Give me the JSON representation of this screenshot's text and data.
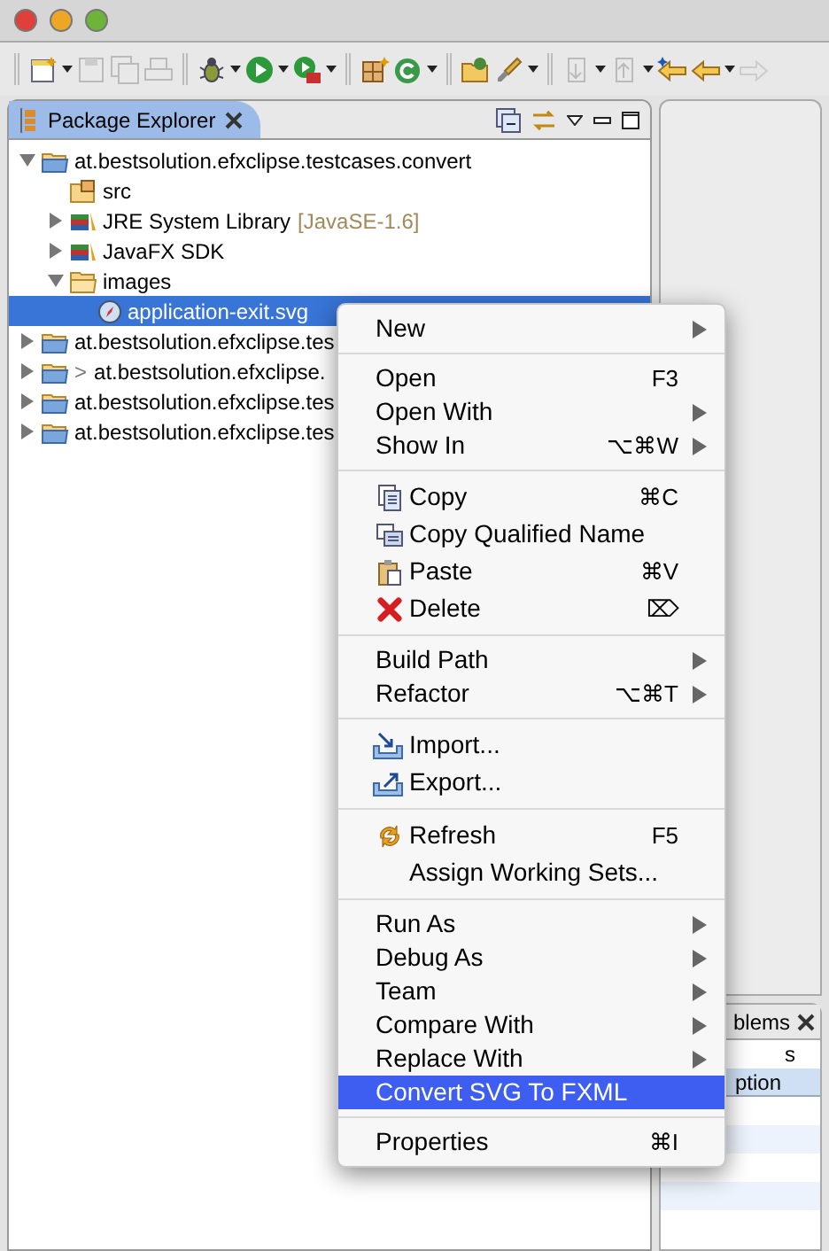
{
  "view_tab": {
    "label": "Package Explorer",
    "selected": true
  },
  "tree": [
    {
      "kind": "project",
      "label": "at.bestsolution.efxclipse.testcases.convert",
      "expanded": true,
      "selected": false,
      "children": [
        {
          "kind": "source",
          "label": "src",
          "selected": false
        },
        {
          "kind": "library",
          "label": "JRE System Library",
          "decoration": "[JavaSE-1.6]",
          "expanded": false,
          "selected": false
        },
        {
          "kind": "library",
          "label": "JavaFX SDK",
          "expanded": false,
          "selected": false
        },
        {
          "kind": "folder",
          "label": "images",
          "expanded": true,
          "selected": false,
          "children": [
            {
              "kind": "file",
              "label": "application-exit.svg",
              "selected": true
            }
          ]
        }
      ]
    },
    {
      "kind": "project",
      "label": "at.bestsolution.efxclipse.tes",
      "expanded": false,
      "selected": false
    },
    {
      "kind": "project",
      "prefix": ">",
      "label": "at.bestsolution.efxclipse.",
      "expanded": false,
      "selected": false
    },
    {
      "kind": "project",
      "label": "at.bestsolution.efxclipse.tes",
      "expanded": false,
      "selected": false
    },
    {
      "kind": "project",
      "label": "at.bestsolution.efxclipse.tes",
      "expanded": false,
      "selected": false
    }
  ],
  "context_menu": [
    [
      {
        "label": "New",
        "submenu": true,
        "selected": false
      }
    ],
    [
      {
        "label": "Open",
        "shortcut": "F3",
        "submenu": false,
        "selected": false
      },
      {
        "label": "Open With",
        "submenu": true,
        "selected": false
      },
      {
        "label": "Show In",
        "shortcut": "⌥⌘W",
        "submenu": true,
        "selected": false
      }
    ],
    [
      {
        "label": "Copy",
        "shortcut": "⌘C",
        "submenu": false,
        "selected": false
      },
      {
        "label": "Copy Qualified Name",
        "submenu": false,
        "selected": false
      },
      {
        "label": "Paste",
        "shortcut": "⌘V",
        "submenu": false,
        "selected": false
      },
      {
        "label": "Delete",
        "shortcut": "⌦",
        "submenu": false,
        "selected": false
      }
    ],
    [
      {
        "label": "Build Path",
        "submenu": true,
        "selected": false
      },
      {
        "label": "Refactor",
        "shortcut": "⌥⌘T",
        "submenu": true,
        "selected": false
      }
    ],
    [
      {
        "label": "Import...",
        "submenu": false,
        "selected": false
      },
      {
        "label": "Export...",
        "submenu": false,
        "selected": false
      }
    ],
    [
      {
        "label": "Refresh",
        "shortcut": "F5",
        "submenu": false,
        "selected": false
      },
      {
        "label": "Assign Working Sets...",
        "submenu": false,
        "selected": false
      }
    ],
    [
      {
        "label": "Run As",
        "submenu": true,
        "selected": false
      },
      {
        "label": "Debug As",
        "submenu": true,
        "selected": false
      },
      {
        "label": "Team",
        "submenu": true,
        "selected": false
      },
      {
        "label": "Compare With",
        "submenu": true,
        "selected": false
      },
      {
        "label": "Replace With",
        "submenu": true,
        "selected": false
      },
      {
        "label": "Convert SVG To FXML",
        "submenu": false,
        "selected": true
      }
    ],
    [
      {
        "label": "Properties",
        "shortcut": "⌘I",
        "submenu": false,
        "selected": false
      }
    ]
  ],
  "problems_view": {
    "tab_label": "blems",
    "summary": "s",
    "column_header": "ption"
  }
}
